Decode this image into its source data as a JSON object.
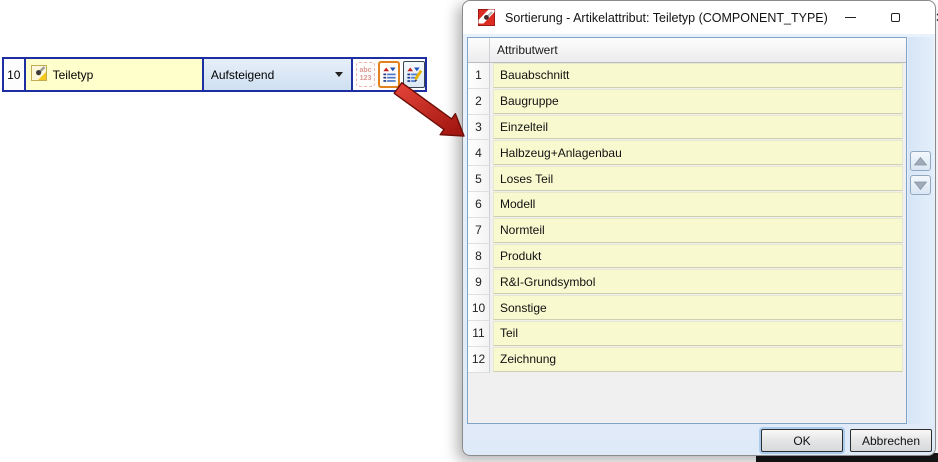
{
  "colors": {
    "accent_navy": "#1c2ea2",
    "row_yellow": "#f9f9d0",
    "attribute_cell_yellow": "#ffffcc",
    "dialog_bg": "#e7f1fb",
    "selection_orange": "#e2811f",
    "arrow_red": "#c0201a",
    "grid_border_blue": "#7fa3c8"
  },
  "toolbar": {
    "row_number": "10",
    "attribute": "Teiletyp",
    "direction": "Aufsteigend",
    "abc_icon_line1": "abc",
    "abc_icon_line2": "123"
  },
  "dialog": {
    "title": "Sortierung - Artikelattribut: Teiletyp (COMPONENT_TYPE)",
    "table": {
      "header": "Attributwert",
      "rows": [
        {
          "num": "1",
          "value": "Bauabschnitt"
        },
        {
          "num": "2",
          "value": "Baugruppe"
        },
        {
          "num": "3",
          "value": "Einzelteil"
        },
        {
          "num": "4",
          "value": "Halbzeug+Anlagenbau"
        },
        {
          "num": "5",
          "value": "Loses Teil"
        },
        {
          "num": "6",
          "value": "Modell"
        },
        {
          "num": "7",
          "value": "Normteil"
        },
        {
          "num": "8",
          "value": "Produkt"
        },
        {
          "num": "9",
          "value": "R&I-Grundsymbol"
        },
        {
          "num": "10",
          "value": "Sonstige"
        },
        {
          "num": "11",
          "value": "Teil"
        },
        {
          "num": "12",
          "value": "Zeichnung"
        }
      ]
    },
    "buttons": {
      "ok": "OK",
      "cancel": "Abbrechen"
    }
  }
}
